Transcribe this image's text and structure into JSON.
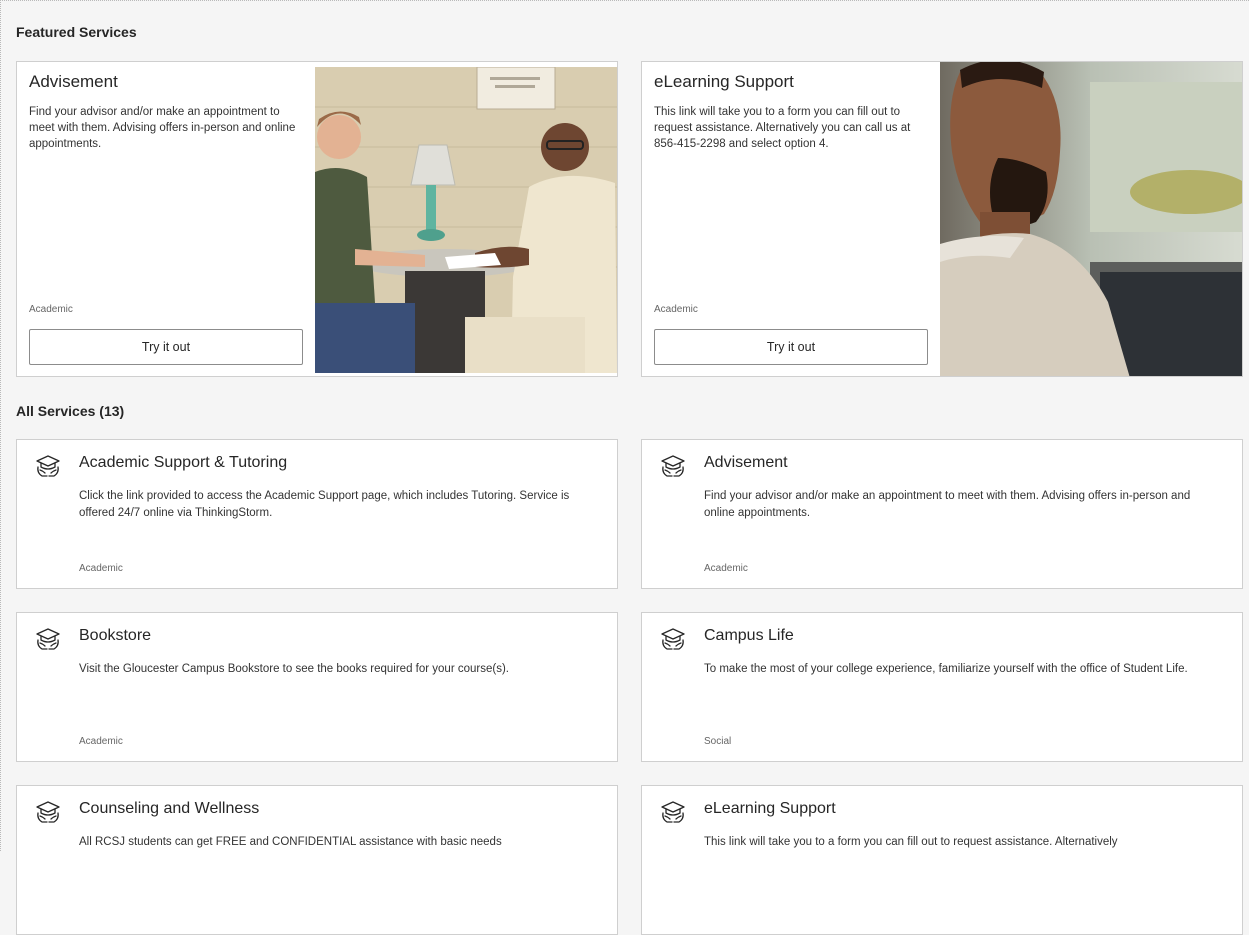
{
  "featured": {
    "heading": "Featured Services",
    "cards": [
      {
        "title": "Advisement",
        "description": "Find your advisor and/or make an appointment to meet with them. Advising offers in-person and online appointments.",
        "category": "Academic",
        "button_label": "Try it out",
        "image_icon": "advising-meeting-photo"
      },
      {
        "title": "eLearning Support",
        "description": "This link will take you to a form you can fill out to request assistance. Alternatively you can call us at 856-415-2298 and select option 4.",
        "category": "Academic",
        "button_label": "Try it out",
        "image_icon": "student-profile-photo"
      }
    ]
  },
  "all_services": {
    "heading_label": "All Services",
    "heading_count": "(13)",
    "items": [
      {
        "title": "Academic Support & Tutoring",
        "description": "Click the link provided to access the Academic Support page, which includes Tutoring. Service is offered 24/7 online via ThinkingStorm.",
        "category": "Academic",
        "icon": "graduation-cap-hands-icon"
      },
      {
        "title": "Advisement",
        "description": "Find your advisor and/or make an appointment to meet with them. Advising offers in-person and online appointments.",
        "category": "Academic",
        "icon": "graduation-cap-hands-icon"
      },
      {
        "title": "Bookstore",
        "description": "Visit the Gloucester Campus Bookstore to see the books required for your course(s).",
        "category": "Academic",
        "icon": "graduation-cap-hands-icon"
      },
      {
        "title": "Campus Life",
        "description": "To make the most of your college experience, familiarize yourself with the office of Student Life.",
        "category": "Social",
        "icon": "graduation-cap-hands-icon"
      },
      {
        "title": "Counseling and Wellness",
        "description": "All RCSJ students can get FREE and CONFIDENTIAL assistance with basic needs",
        "category": "",
        "icon": "graduation-cap-hands-icon"
      },
      {
        "title": "eLearning Support",
        "description": "This link will take you to a form you can fill out to request assistance. Alternatively",
        "category": "",
        "icon": "graduation-cap-hands-icon"
      }
    ]
  }
}
